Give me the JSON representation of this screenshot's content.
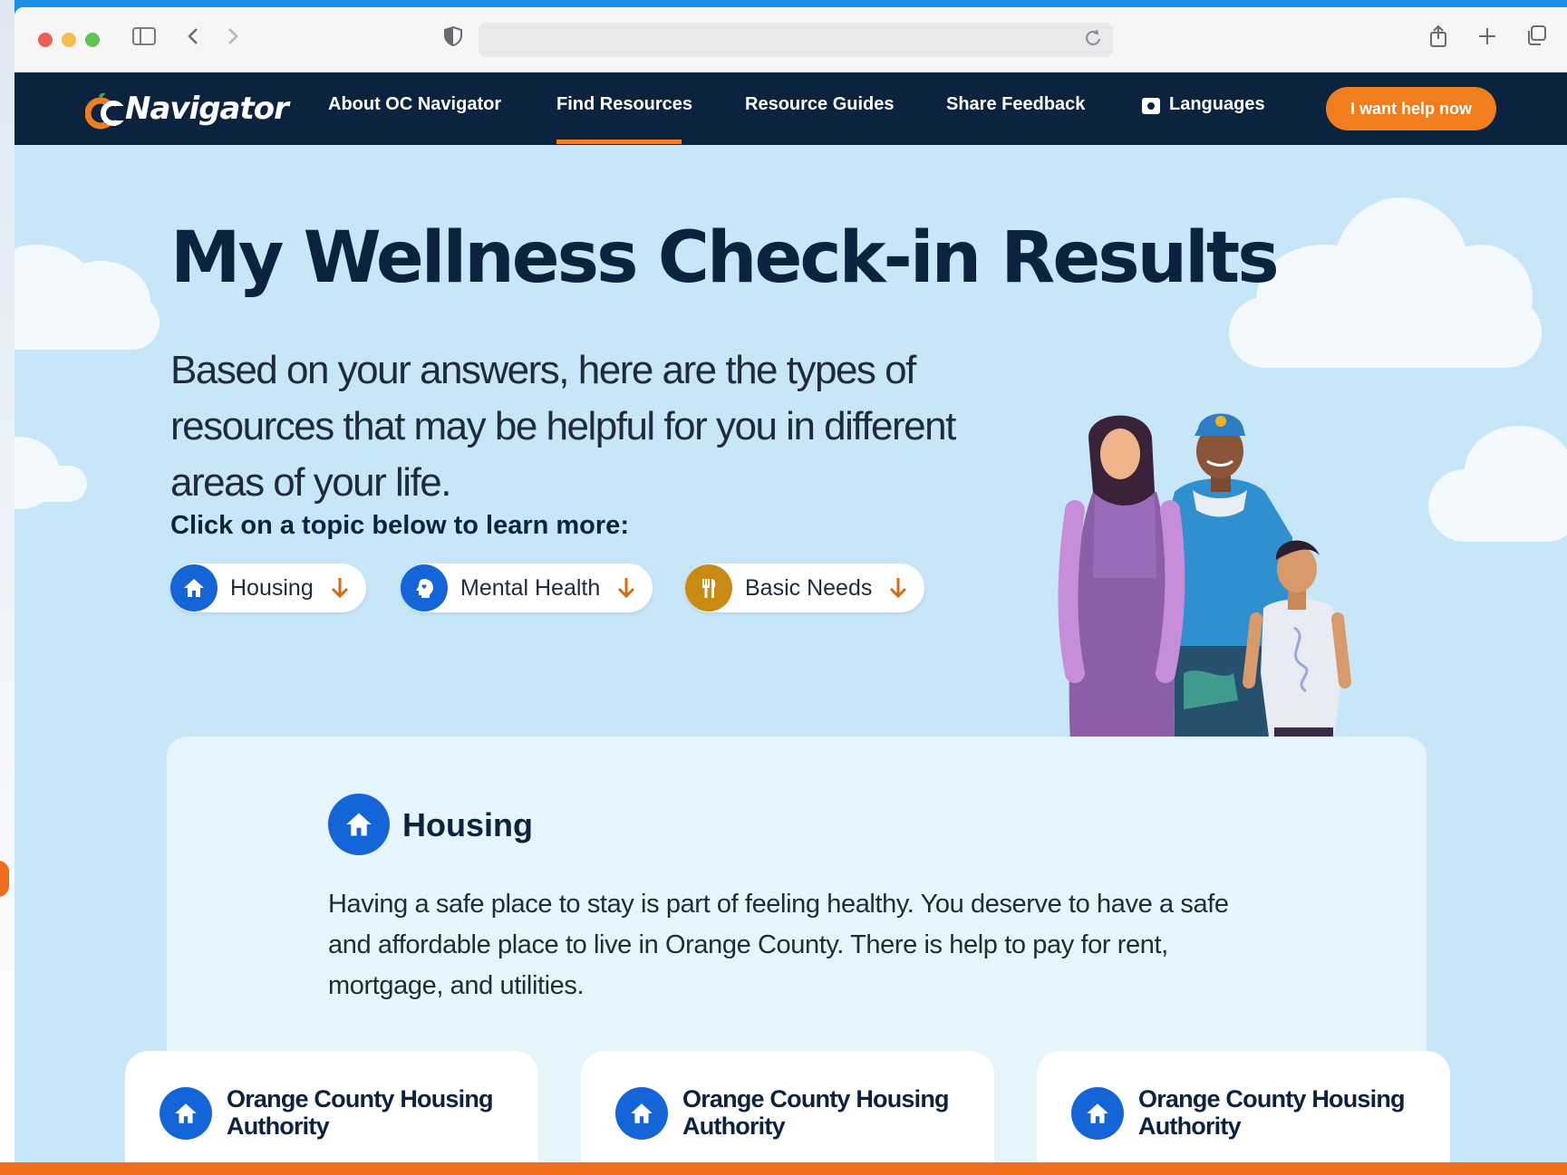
{
  "browser": {
    "sidebar_icon": "sidebar-icon",
    "back_icon": "chevron-left-icon",
    "forward_icon": "chevron-right-icon",
    "privacy_icon": "shield-icon",
    "reload_icon": "reload-icon",
    "share_icon": "share-icon",
    "new_tab_icon": "plus-icon",
    "tabs_icon": "tabs-icon"
  },
  "nav": {
    "logo_text": "Navigator",
    "links": [
      "About OC Navigator",
      "Find Resources",
      "Resource Guides",
      "Share Feedback",
      "Languages"
    ],
    "active_link": "Find Resources",
    "help_button": "I want help now"
  },
  "hero": {
    "title": "My Wellness Check-in  Results",
    "subtitle": "Based on your answers, here are the types of resources that may be helpful for you in different areas of your life.",
    "topic_prompt": "Click on a topic below to learn more:",
    "topics": [
      {
        "label": "Housing",
        "icon": "home-icon",
        "color": "#1466d8"
      },
      {
        "label": "Mental Health",
        "icon": "heart-head-icon",
        "color": "#1466d8"
      },
      {
        "label": "Basic Needs",
        "icon": "utensils-icon",
        "color": "#c98a12"
      }
    ]
  },
  "section": {
    "title": "Housing",
    "icon": "home-icon",
    "description": "Having a safe place to stay is part of feeling healthy. You deserve to have a safe and affordable place to live in Orange County. There is help to pay for rent, mortgage, and utilities.",
    "resources": [
      {
        "title": "Orange County Housing Authority"
      },
      {
        "title": "Orange County Housing Authority"
      },
      {
        "title": "Orange County Housing Authority"
      }
    ]
  },
  "colors": {
    "nav_bg": "#0c2340",
    "accent_orange": "#f07e1f",
    "sky": "#c7e6f7",
    "primary_blue": "#1466d8"
  }
}
